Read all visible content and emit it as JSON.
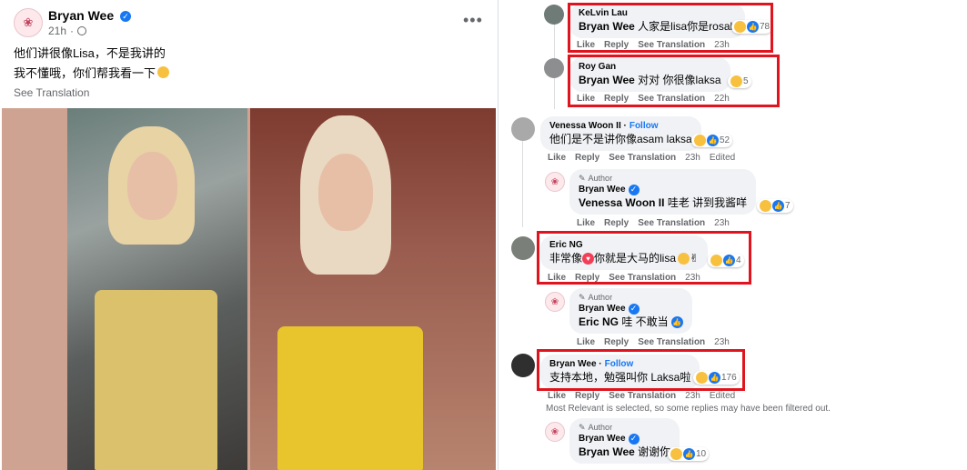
{
  "post": {
    "author": "Bryan Wee",
    "time": "21h",
    "text_line1": "他们讲很像Lisa，不是我讲的",
    "text_line2": "我不懂哦，你们帮我看一下",
    "see_translation": "See Translation"
  },
  "comments": [
    {
      "name": "KeLvin Lau",
      "text_bold": "Bryan Wee",
      "text": " 人家是lisa你是rosak",
      "count": "78",
      "like": "Like",
      "reply": "Reply",
      "translate": "See Translation",
      "time": "23h"
    },
    {
      "name": "Roy Gan",
      "text_bold": "Bryan Wee",
      "text": " 对对 你很像laksa",
      "count": "5",
      "like": "Like",
      "reply": "Reply",
      "translate": "See Translation",
      "time": "22h"
    },
    {
      "name": "Venessa Woon II",
      "follow": "Follow",
      "text": "他们是不是讲你像asam laksa",
      "count": "52",
      "like": "Like",
      "reply": "Reply",
      "translate": "See Translation",
      "time": "23h",
      "edited": "Edited"
    },
    {
      "author_tag": "Author",
      "name": "Bryan Wee",
      "text_bold": "Venessa Woon II",
      "text": " 哇老 讲到我酱咩",
      "count": "7",
      "like": "Like",
      "reply": "Reply",
      "translate": "See Translation",
      "time": "23h"
    },
    {
      "name": "Eric NG",
      "text": "非常像",
      "text2": "你就是大马的lisa",
      "count": "4",
      "like": "Like",
      "reply": "Reply",
      "translate": "See Translation",
      "time": "23h"
    },
    {
      "author_tag": "Author",
      "name": "Bryan Wee",
      "text_bold": "Eric NG",
      "text": " 哇 不敢当",
      "like": "Like",
      "reply": "Reply",
      "translate": "See Translation",
      "time": "23h"
    },
    {
      "name": "Bryan Wee",
      "follow": "Follow",
      "text": "支持本地，勉强叫你 Laksa啦",
      "count": "176",
      "like": "Like",
      "reply": "Reply",
      "translate": "See Translation",
      "time": "23h",
      "edited": "Edited"
    },
    {
      "author_tag": "Author",
      "name": "Bryan Wee",
      "text_bold": "Bryan Wee",
      "text": " 谢谢你",
      "count": "10"
    }
  ],
  "filter_note": "Most Relevant is selected, so some replies may have been filtered out.",
  "colors": {
    "highlight": "#e0141e",
    "link": "#1877f2",
    "muted": "#65676b",
    "bubble": "#f0f2f5"
  }
}
